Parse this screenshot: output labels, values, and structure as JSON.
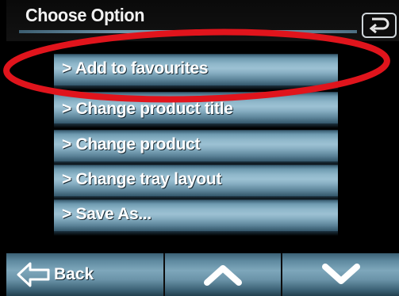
{
  "header": {
    "title": "Choose Option",
    "return_icon": "return-arrow-icon"
  },
  "menu": {
    "items": [
      {
        "label": "> Add to favourites"
      },
      {
        "label": "> Change product title"
      },
      {
        "label": "> Change product"
      },
      {
        "label": "> Change tray layout"
      },
      {
        "label": "> Save As..."
      }
    ]
  },
  "toolbar": {
    "back_label": "Back",
    "back_icon": "back-arrow-icon",
    "up_icon": "chevron-up-icon",
    "down_icon": "chevron-down-icon"
  },
  "colors": {
    "background": "#000000",
    "bar_light": "#9cc1d3",
    "bar_dark": "#33566a",
    "highlight": "#e0141c"
  }
}
